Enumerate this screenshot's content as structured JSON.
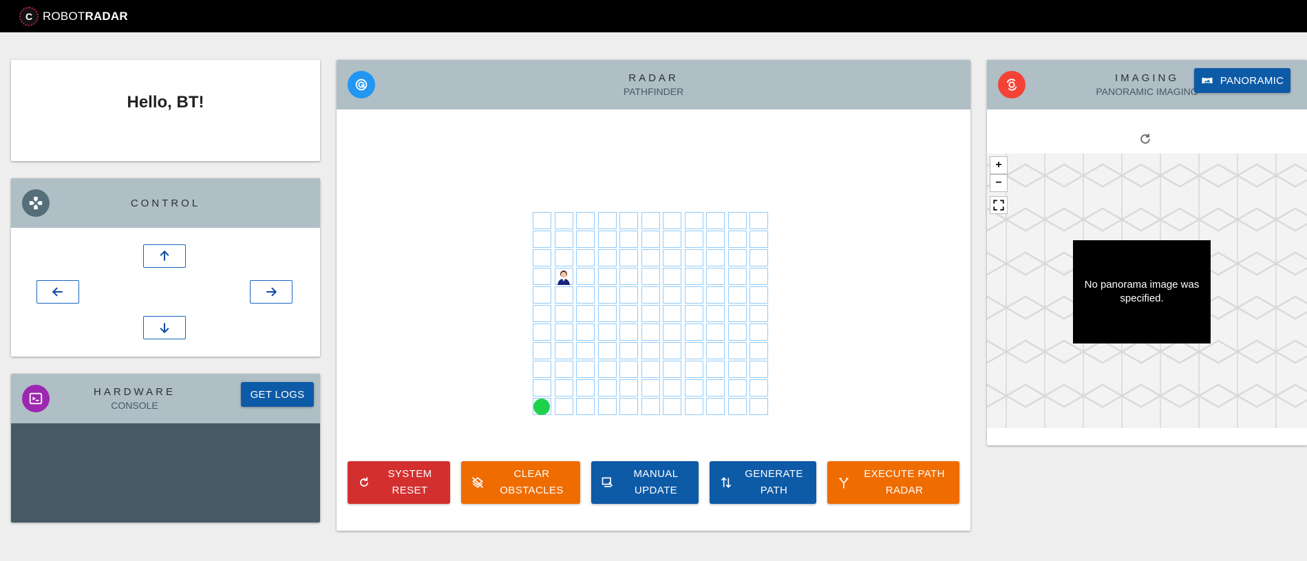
{
  "app": {
    "logo_letter": "C",
    "brand_light": "ROBOT",
    "brand_bold": "RADAR"
  },
  "greeting": {
    "text": "Hello, BT!"
  },
  "control": {
    "title": "CONTROL",
    "icon": "gamepad-icon",
    "buttons": [
      "arrow-up",
      "arrow-left",
      "arrow-right",
      "arrow-down"
    ]
  },
  "hardware": {
    "title": "HARDWARE",
    "subtitle": "CONSOLE",
    "icon": "terminal-icon",
    "logs_button": "GET LOGS"
  },
  "radar": {
    "title": "RADAR",
    "subtitle": "PATHFINDER",
    "icon": "radar-icon",
    "grid": {
      "cols": 11,
      "rows": 11,
      "robot": {
        "col": 1,
        "row": 3
      },
      "goal": {
        "col": 0,
        "row": 10
      }
    },
    "actions": [
      {
        "line1": "SYSTEM",
        "line2": "RESET",
        "color": "#d32f2f",
        "icon": "refresh-icon"
      },
      {
        "line1": "CLEAR",
        "line2": "OBSTACLES",
        "color": "#ef6c00",
        "icon": "layers-clear-icon"
      },
      {
        "line1": "MANUAL",
        "line2": "UPDATE",
        "color": "#0d5aa7",
        "icon": "manual-update-icon"
      },
      {
        "line1": "GENERATE",
        "line2": "PATH",
        "color": "#0d5aa7",
        "icon": "swap-vertical-icon"
      },
      {
        "line1": "EXECUTE PATH",
        "line2": "RADAR",
        "color": "#ef6c00",
        "icon": "fork-icon"
      }
    ]
  },
  "imaging": {
    "title": "IMAGING",
    "subtitle": "PANORAMIC IMAGING",
    "icon": "camera-rotate-icon",
    "panoramic_button": "PANORAMIC",
    "zoom_in": "+",
    "zoom_out": "−",
    "message": "No panorama image was specified."
  },
  "colors": {
    "header_bg": "#b0bec5",
    "console_bg": "#455a64",
    "control_icon_bg": "#546e7a",
    "hardware_icon_bg": "#9c27b0",
    "radar_icon_bg": "#2196f3",
    "imaging_icon_bg": "#f44336",
    "primary_button": "#0d5aa7"
  }
}
